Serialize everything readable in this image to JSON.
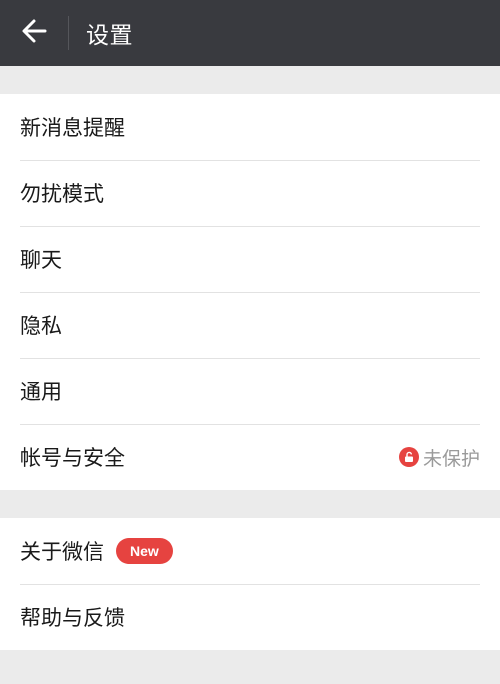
{
  "header": {
    "title": "设置",
    "back_icon": "arrow-left-icon"
  },
  "colors": {
    "header_bg": "#393a3f",
    "page_bg": "#ebebeb",
    "accent_red": "#e64340",
    "muted_text": "#9a9a9a"
  },
  "groups": [
    {
      "items": [
        {
          "label": "新消息提醒"
        },
        {
          "label": "勿扰模式"
        },
        {
          "label": "聊天"
        },
        {
          "label": "隐私"
        },
        {
          "label": "通用"
        },
        {
          "label": "帐号与安全",
          "status": "未保护",
          "status_icon": "lock-open-icon"
        }
      ]
    },
    {
      "items": [
        {
          "label": "关于微信",
          "badge": "New"
        },
        {
          "label": "帮助与反馈"
        }
      ]
    }
  ]
}
